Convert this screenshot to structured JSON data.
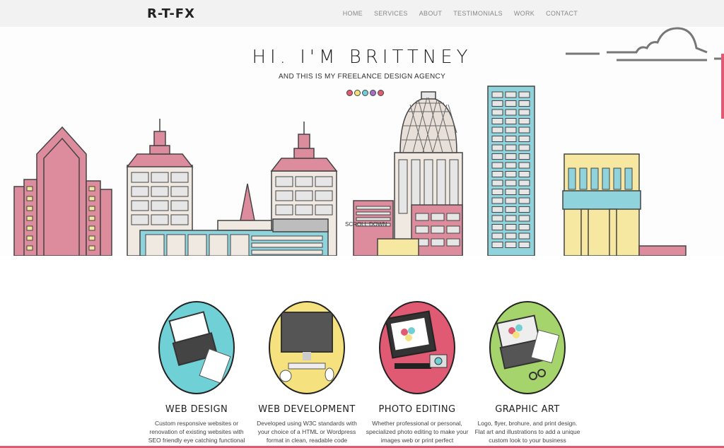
{
  "header": {
    "logo": "R-T-FX",
    "nav": [
      "HOME",
      "SERVICES",
      "ABOUT",
      "TESTIMONIALS",
      "WORK",
      "CONTACT"
    ]
  },
  "hero": {
    "title": "HI. I'M BRITTNEY",
    "subtitle": "AND THIS IS MY FREELANCE DESIGN AGENCY",
    "scroll_label": "SCROLL DOWN",
    "dot_colors": [
      "#e05a73",
      "#f2e07a",
      "#6fd0d6",
      "#a66ec9",
      "#e05a73"
    ]
  },
  "services": [
    {
      "title": "WEB DESIGN",
      "text": "Custom responsive websites or renovation of existing websites with SEO friendly eye catching functional",
      "color": "#6fd0d6"
    },
    {
      "title": "WEB DEVELOPMENT",
      "text": "Developed using W3C standards with your choice of a HTML or Wordpress format in clean, readable code",
      "color": "#f5e27f"
    },
    {
      "title": "PHOTO EDITING",
      "text": "Whether professional or personal, specialized photo editing to make your images web or print perfect",
      "color": "#e05a73"
    },
    {
      "title": "GRAPHIC ART",
      "text": "Logo, flyer, brohure, and print design. Flat art and illustrations to add a unique custom look to your business",
      "color": "#a6d46c"
    }
  ],
  "colors": {
    "pink": "#dc8c9c",
    "teal": "#8fd3dc",
    "yellow": "#f6e7a1",
    "cream": "#efe9e2",
    "gray": "#e6e6e6"
  }
}
